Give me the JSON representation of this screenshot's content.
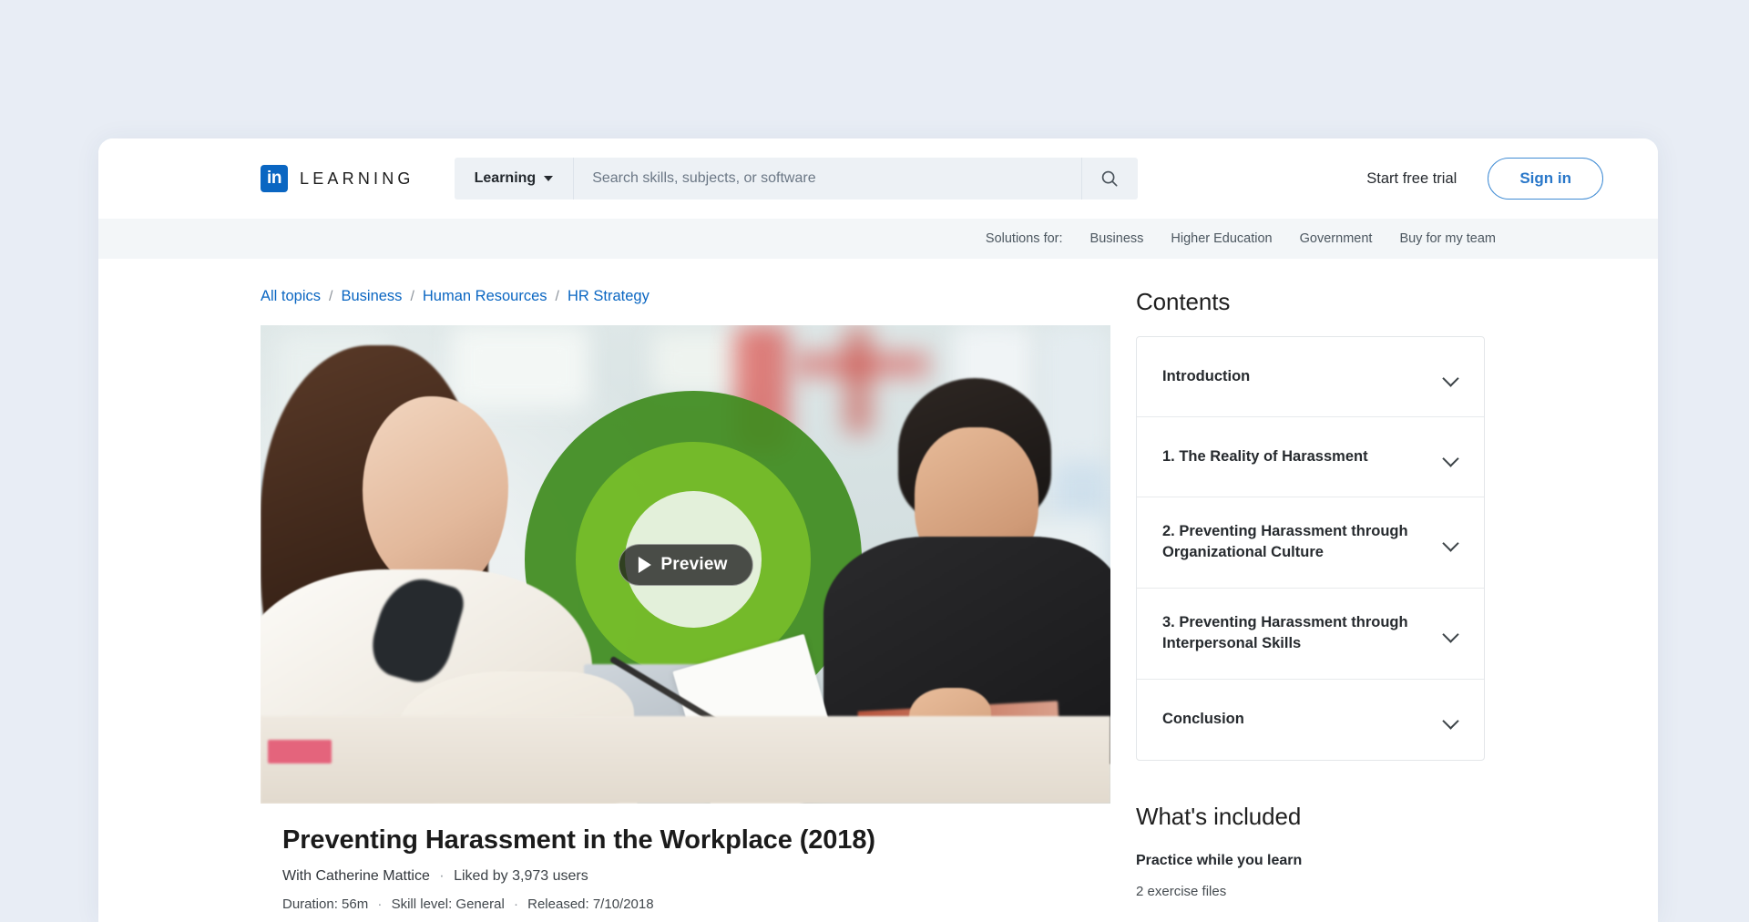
{
  "header": {
    "logo_icon": "linkedin-in-icon",
    "brand_word": "LEARNING",
    "search_scope": "Learning",
    "search_placeholder": "Search skills, subjects, or software",
    "search_value": "",
    "search_icon": "search-icon",
    "caret_icon": "chevron-down-icon",
    "trial_label": "Start free trial",
    "signin_label": "Sign in",
    "accent_blue": "#0a66c2"
  },
  "subnav": {
    "label": "Solutions for:",
    "links": [
      "Business",
      "Higher Education",
      "Government",
      "Buy for my team"
    ]
  },
  "breadcrumb": {
    "separator": "/",
    "items": [
      "All topics",
      "Business",
      "Human Resources",
      "HR Strategy"
    ]
  },
  "video": {
    "preview_label": "Preview",
    "play_icon": "play-icon",
    "alt_description": "Two coworkers reviewing documents at a table with green concentric arc graphic"
  },
  "course": {
    "title": "Preventing Harassment in the Workplace (2018)",
    "author": "With Catherine Mattice",
    "likes": "Liked by 3,973 users",
    "duration": "Duration: 56m",
    "skill_level": "Skill level: General",
    "released": "Released: 7/10/2018",
    "separator": "·"
  },
  "contents": {
    "heading": "Contents",
    "chevron_icon": "chevron-down-icon",
    "sections": [
      "Introduction",
      "1. The Reality of Harassment",
      "2. Preventing Harassment through Organizational Culture",
      "3. Preventing Harassment through Interpersonal Skills",
      "Conclusion"
    ]
  },
  "included": {
    "heading": "What's included",
    "title": "Practice while you learn",
    "detail": "2 exercise files"
  }
}
